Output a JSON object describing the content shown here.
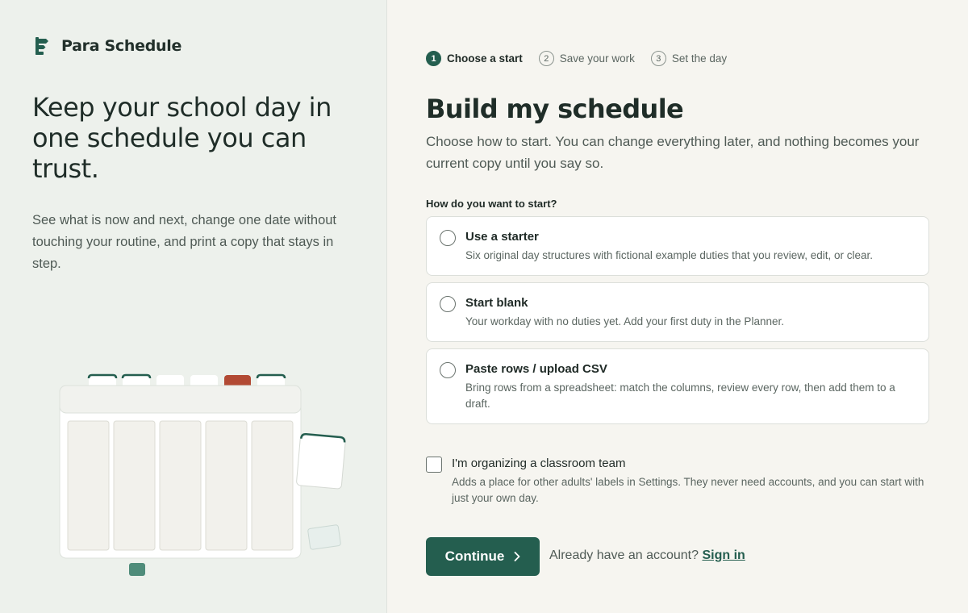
{
  "brand": {
    "name": "Para Schedule",
    "icon": "signpost-logo-icon",
    "accent": "#245e4f"
  },
  "hero": {
    "title": "Keep your school day in one schedule you can trust.",
    "text": "See what is now and next, change one date without touching your routine, and print a copy that stays in step."
  },
  "stepper": {
    "steps": [
      {
        "num": "1",
        "label": "Choose a start",
        "active": true
      },
      {
        "num": "2",
        "label": "Save your work",
        "active": false
      },
      {
        "num": "3",
        "label": "Set the day",
        "active": false
      }
    ]
  },
  "main": {
    "title": "Build my schedule",
    "subtitle": "Choose how to start. You can change everything later, and nothing becomes your current copy until you say so.",
    "question": "How do you want to start?",
    "options": [
      {
        "title": "Use a starter",
        "desc": "Six original day structures with fictional example duties that you review, edit, or clear."
      },
      {
        "title": "Start blank",
        "desc": "Your workday with no duties yet. Add your first duty in the Planner."
      },
      {
        "title": "Paste rows / upload CSV",
        "desc": "Bring rows from a spreadsheet: match the columns, review every row, then add them to a draft."
      }
    ],
    "team": {
      "label": "I'm organizing a classroom team",
      "desc": "Adds a place for other adults' labels in Settings. They never need accounts, and you can start with just your own day."
    },
    "continue_label": "Continue",
    "signin_prompt": "Already have an account?",
    "signin_link": "Sign in"
  }
}
